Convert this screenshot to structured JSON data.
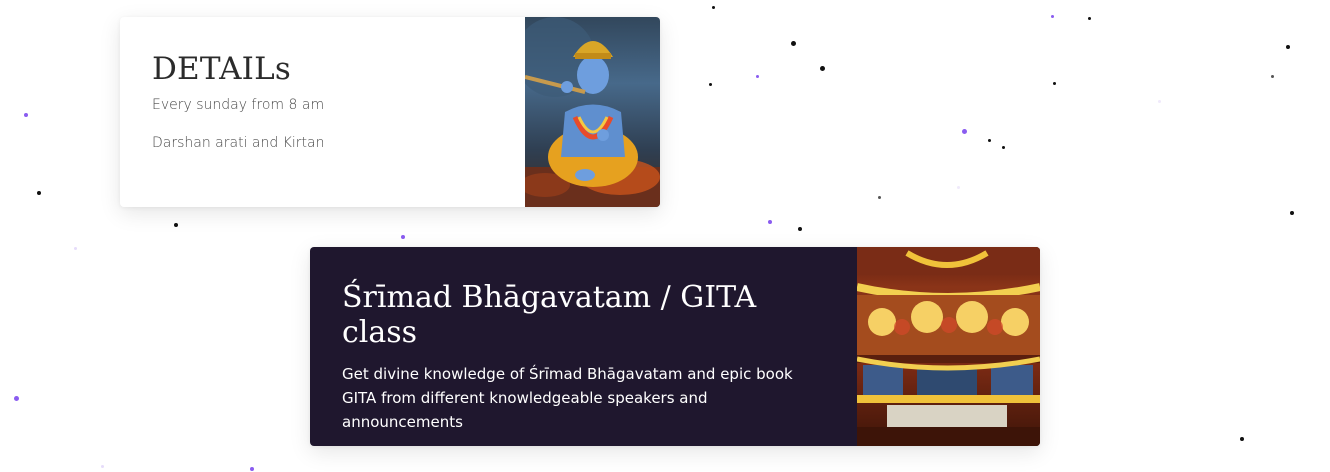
{
  "colors": {
    "card_dark_bg": "#1f172e",
    "card_light_bg": "#ffffff",
    "particle_dark": "#111111",
    "particle_purple": "#8a5cf0"
  },
  "details_card": {
    "title": "DETAILs",
    "lines": [
      "Every sunday from 8 am",
      "Darshan arati and Kirtan"
    ],
    "image": "krishna-playing-flute-illustration"
  },
  "class_card": {
    "title": "Śrīmad Bhāgavatam / GITA class",
    "description": "Get divine knowledge of  Śrīmad Bhāgavatam and epic book GITA from different knowledgeable speakers and announcements",
    "image": "temple-altar-deities-photo"
  }
}
